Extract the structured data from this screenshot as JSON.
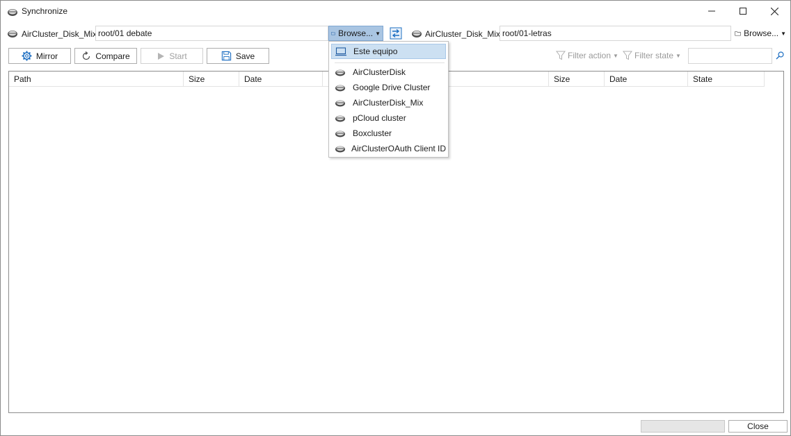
{
  "window": {
    "title": "Synchronize",
    "controls": [
      "minimize",
      "maximize",
      "close"
    ]
  },
  "left": {
    "drive_label": "AirCluster_Disk_Mix",
    "path_value": "root/01 debate",
    "browse_label": "Browse..."
  },
  "right": {
    "drive_label": "AirCluster_Disk_Mix",
    "path_value": "root/01-letras",
    "browse_label": "Browse..."
  },
  "toolbar": {
    "mirror_label": "Mirror",
    "compare_label": "Compare",
    "start_label": "Start",
    "save_label": "Save",
    "filter_action_label": "Filter action",
    "filter_state_label": "Filter state",
    "search_value": ""
  },
  "grid": {
    "columns": [
      "Path",
      "Size",
      "Date",
      "Size",
      "Date",
      "State"
    ]
  },
  "browse_menu": {
    "items": [
      {
        "label": "Este equipo",
        "icon": "computer-icon",
        "selected": true
      },
      {
        "label": "AirClusterDisk",
        "icon": "cloud-drive-icon"
      },
      {
        "label": "Google Drive Cluster",
        "icon": "cloud-drive-icon"
      },
      {
        "label": "AirClusterDisk_Mix",
        "icon": "cloud-drive-icon"
      },
      {
        "label": "pCloud cluster",
        "icon": "cloud-drive-icon"
      },
      {
        "label": "Boxcluster",
        "icon": "cloud-drive-icon"
      },
      {
        "label": "AirClusterOAuth Client ID",
        "icon": "cloud-drive-icon"
      }
    ]
  },
  "footer": {
    "close_label": "Close"
  },
  "colors": {
    "menu_selected_bg": "#cce0f2",
    "browse_active_bg": "#a9c5e2",
    "accent_blue": "#1e6fc2"
  }
}
